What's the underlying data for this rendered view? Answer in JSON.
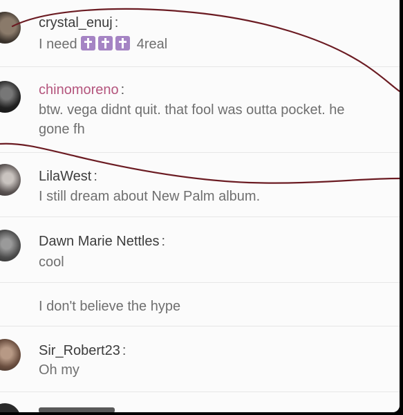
{
  "comments": [
    {
      "username": "crystal_enuj",
      "separator": ":",
      "message_before": "I need",
      "message_after": "4real",
      "emoji_name": "latin-cross-emoji"
    },
    {
      "username": "chinomoreno",
      "separator": ":",
      "message": "btw. vega didnt quit. that fool was outta pocket. he gone fh"
    },
    {
      "username": "LilaWest",
      "separator": ":",
      "message": "I still dream about New Palm album."
    },
    {
      "username": "Dawn Marie Nettles",
      "separator": ":",
      "message": "cool"
    },
    {
      "message": "I don't believe the hype"
    },
    {
      "username": "Sir_Robert23",
      "separator": ":",
      "message": "Oh my"
    }
  ],
  "colors": {
    "username_default": "#3c3c3c",
    "username_highlight": "#b4557d",
    "message_text": "#6f6f6f",
    "emoji_background": "#a584c4",
    "scribble": "#6b1b22",
    "background": "#fbfbfb"
  }
}
